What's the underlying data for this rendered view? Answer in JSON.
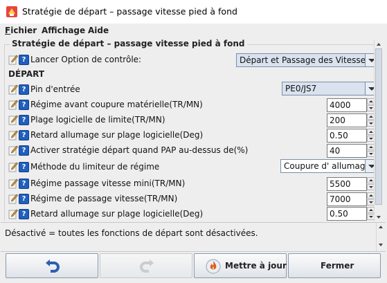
{
  "window": {
    "title": "Stratégie de départ – passage vitesse pied à fond"
  },
  "menu": {
    "items": [
      "Fichier",
      "Affichage",
      "Aide"
    ]
  },
  "panel": {
    "legend": "Stratégie de départ – passage vitesse pied à fond",
    "section_depart": "DÉPART",
    "rows": [
      {
        "label": "Lancer Option de contrôle:",
        "control": "combo",
        "value": "Départ et Passage des Vitesses"
      },
      {
        "label": "Pin d'entrée",
        "control": "combo",
        "value": "PE0/JS7"
      },
      {
        "label": "Régime avant coupure matérielle(TR/MN)",
        "control": "spinner",
        "value": "4000"
      },
      {
        "label": "Plage logicielle de limite(TR/MN)",
        "control": "spinner",
        "value": "200"
      },
      {
        "label": "Retard allumage sur plage logicielle(Deg)",
        "control": "spinner",
        "value": "0.50"
      },
      {
        "label": "Activer stratégie départ quand PAP au-dessus de(%)",
        "control": "spinner",
        "value": "40"
      },
      {
        "label": "Méthode du limiteur de régime",
        "control": "combo",
        "value": "Coupure d' allumage"
      },
      {
        "label": "Régime passage vitesse mini(TR/MN)",
        "control": "spinner",
        "value": "5500"
      },
      {
        "label": "Régime de passage vitesse(TR/MN)",
        "control": "spinner",
        "value": "7000"
      },
      {
        "label": "Retard allumage sur plage logicielle(Deg)",
        "control": "spinner",
        "value": "0.50"
      }
    ],
    "help_glyph": "?"
  },
  "description": {
    "text": "Désactivé = toutes les fonctions de départ sont désactivées."
  },
  "buttons": {
    "undo_icon": "undo-arrow-icon",
    "redo_icon": "redo-arrow-icon",
    "update": "Mettre à jour",
    "update_icon": "burn-flame-icon",
    "close": "Fermer"
  },
  "colors": {
    "help_icon": "#1f5fbf",
    "combo_bg": "#d9e2ee",
    "window_bg": "#eeeeee"
  }
}
